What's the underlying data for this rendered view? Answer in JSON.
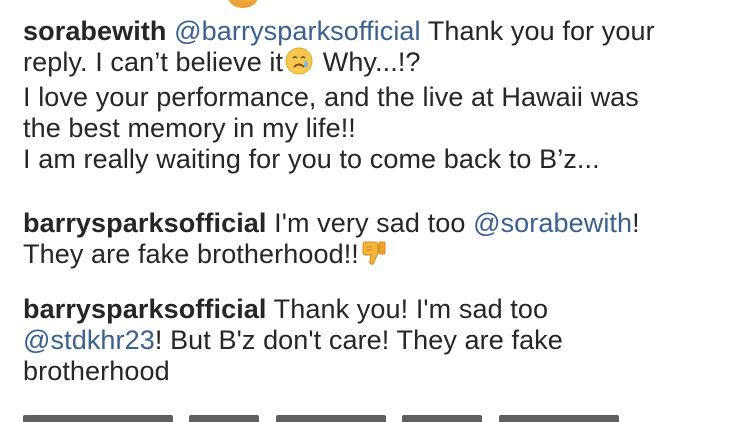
{
  "comments": [
    {
      "username": "sorabewith",
      "mention": "@barrysparksofficial",
      "line1_tail": "Thank you for your",
      "line2_pre": "reply. I can’t believe it",
      "line2_post": "Why...!?",
      "line3": "I love your performance, and the live at Hawaii was",
      "line4": "the best memory in my life!!",
      "line5": "I am really waiting for you to come back to B’z...",
      "emoji": "crying-face-icon"
    },
    {
      "username": "barrysparksofficial",
      "line1_mid": "I'm very sad too",
      "mention": "@sorabewith",
      "line1_tail": "!",
      "line2": "They are fake brotherhood!!",
      "emoji": "thumbs-down-icon"
    },
    {
      "username": "barrysparksofficial",
      "line1_tail": "Thank you! I'm sad too",
      "mention": "@stdkhr23",
      "line2_tail": "! But B'z don't care! They are fake",
      "line3": "brotherhood"
    }
  ],
  "colors": {
    "text": "#262626",
    "mention": "#3b5f8f",
    "background": "#ffffff"
  }
}
